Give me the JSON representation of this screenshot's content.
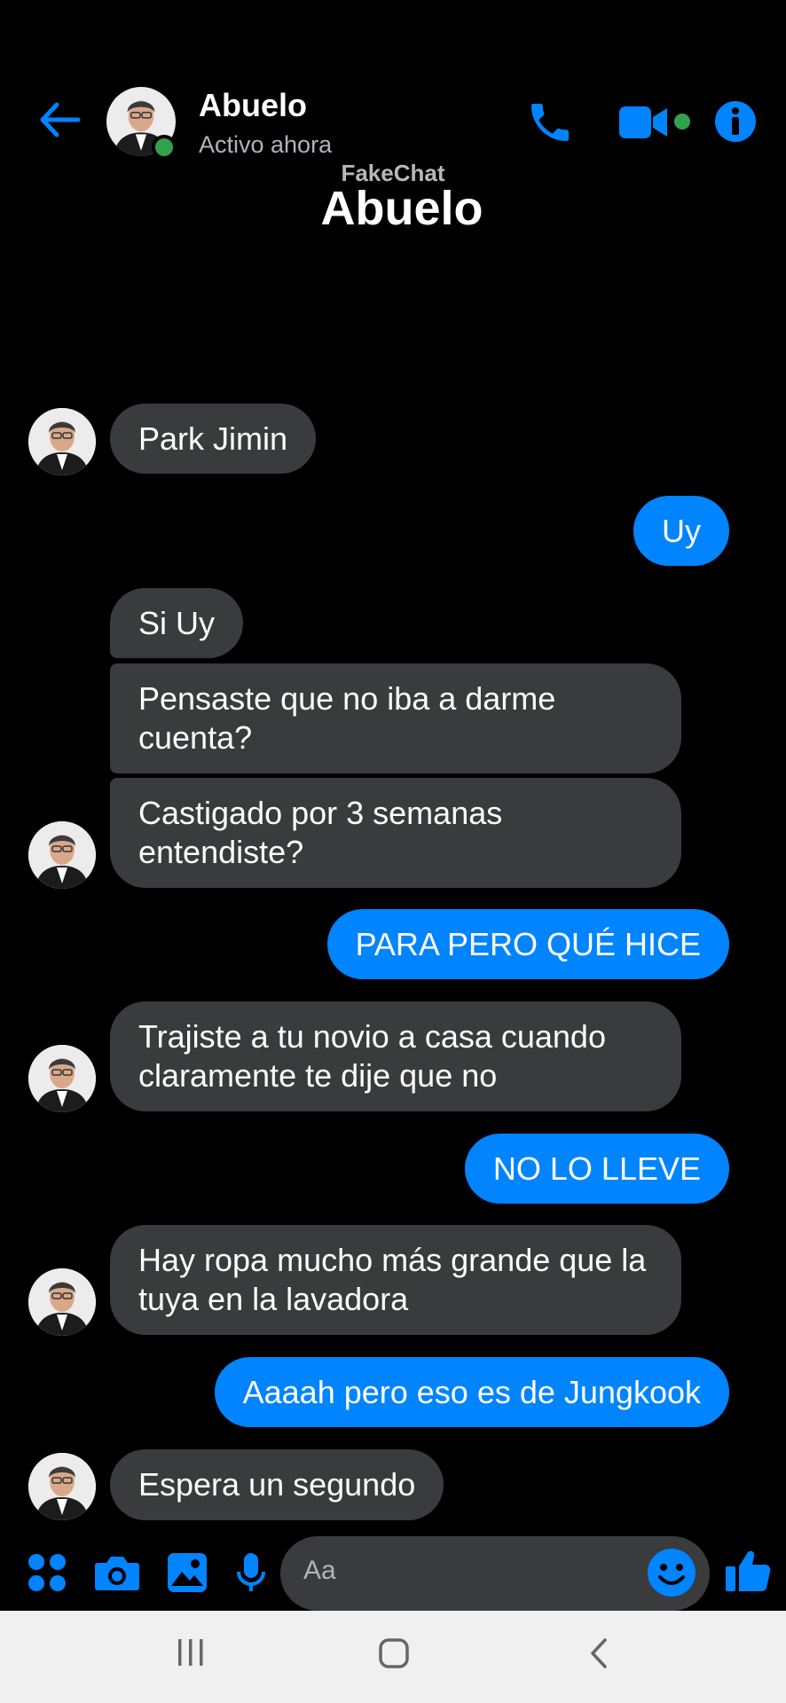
{
  "header": {
    "contact_name": "Abuelo",
    "status": "Activo ahora",
    "back_icon": "arrow-left-icon",
    "call_icon": "phone-icon",
    "video_icon": "video-camera-icon",
    "info_icon": "info-icon"
  },
  "watermark": "FakeChat",
  "conversation_title": "Abuelo",
  "messages": [
    {
      "from": "contact",
      "text": "Park Jimin"
    },
    {
      "from": "me",
      "text": "Uy"
    },
    {
      "from": "contact",
      "text": "Si Uy"
    },
    {
      "from": "contact",
      "text": "Pensaste que no iba a darme cuenta?"
    },
    {
      "from": "contact",
      "text": "Castigado por 3 semanas entendiste?"
    },
    {
      "from": "me",
      "text": "PARA PERO QUÉ HICE"
    },
    {
      "from": "contact",
      "text": "Trajiste a tu novio a casa cuando claramente te dije que no"
    },
    {
      "from": "me",
      "text": "NO LO LLEVE"
    },
    {
      "from": "contact",
      "text": "Hay ropa mucho más grande que la tuya en la lavadora"
    },
    {
      "from": "me",
      "text": "Aaaah pero eso es de Jungkook"
    },
    {
      "from": "contact",
      "text": "Espera un segundo"
    }
  ],
  "composer": {
    "placeholder": "Aa",
    "icons": [
      "apps-grid-icon",
      "camera-icon",
      "gallery-icon",
      "microphone-icon",
      "emoji-icon",
      "thumbs-up-icon"
    ]
  },
  "navbar": {
    "icons": [
      "recent-apps-icon",
      "home-icon",
      "back-icon"
    ]
  },
  "colors": {
    "accent": "#0084ff",
    "incoming_bubble": "#3a3b3c",
    "online": "#31a24c",
    "background": "#000000"
  }
}
